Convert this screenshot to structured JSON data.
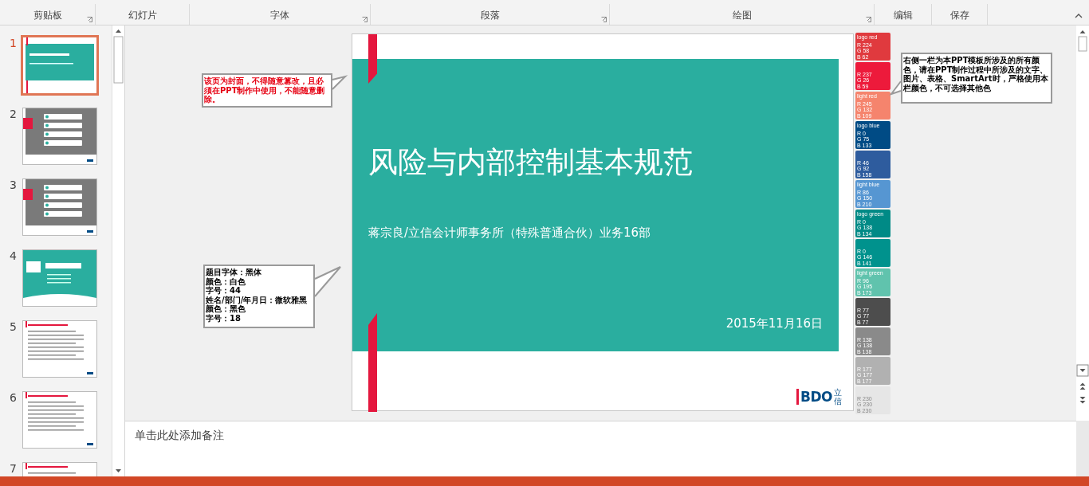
{
  "ribbon": {
    "groups": [
      {
        "label": "剪贴板",
        "launcher": true
      },
      {
        "label": "幻灯片",
        "launcher": false
      },
      {
        "label": "字体",
        "launcher": true
      },
      {
        "label": "段落",
        "launcher": true
      },
      {
        "label": "绘图",
        "launcher": true
      },
      {
        "label": "编辑",
        "launcher": false
      },
      {
        "label": "保存",
        "launcher": false
      }
    ]
  },
  "thumbnails": [
    {
      "number": "1",
      "kind": "cover",
      "selected": true
    },
    {
      "number": "2",
      "kind": "menu",
      "selected": false
    },
    {
      "number": "3",
      "kind": "menu",
      "selected": false
    },
    {
      "number": "4",
      "kind": "section",
      "selected": false
    },
    {
      "number": "5",
      "kind": "text",
      "selected": false
    },
    {
      "number": "6",
      "kind": "text",
      "selected": false
    },
    {
      "number": "7",
      "kind": "text",
      "selected": false
    }
  ],
  "slide": {
    "title": "风险与内部控制基本规范",
    "subtitle": "蒋宗良/立信会计师事务所（特殊普通合伙）业务16部",
    "date": "2015年11月16日",
    "logo_text": "BDO",
    "logo_cjk": "立信"
  },
  "callouts": [
    {
      "kind": "warning",
      "lines": [
        "该页为封面，不得随意篡改，且必须在PPT制作中使用，不能随意删除。"
      ]
    },
    {
      "kind": "note",
      "lines": [
        "题目字体：黑体",
        "颜色：白色",
        "字号：44",
        "姓名/部门/年月日：微软雅黑",
        "颜色：黑色",
        "字号：18"
      ]
    },
    {
      "kind": "note",
      "lines": [
        "右侧一栏为本PPT模板所涉及的所有颜色，请在PPT制作过程中所涉及的文字、图片、表格、SmartArt时，严格使用本栏颜色，不可选择其他色"
      ]
    }
  ],
  "swatches": [
    {
      "name": "logo red",
      "color": "#e03a3e",
      "r": "R 224",
      "g": "G 58",
      "b": "B 62"
    },
    {
      "color": "#ed1a3b",
      "r": "R 237",
      "g": "G 26",
      "b": "B 59"
    },
    {
      "name": "light red",
      "color": "#f5846d",
      "r": "R 245",
      "g": "G 132",
      "b": "B 109"
    },
    {
      "name": "logo blue",
      "color": "#004b85",
      "r": "R 0",
      "g": "G 75",
      "b": "B 133"
    },
    {
      "color": "#2e5c9e",
      "r": "R 46",
      "g": "G 92",
      "b": "B 158"
    },
    {
      "name": "light blue",
      "color": "#5696d2",
      "r": "R 86",
      "g": "G 150",
      "b": "B 210"
    },
    {
      "name": "logo green",
      "color": "#008a86",
      "r": "R 0",
      "g": "G 138",
      "b": "B 134"
    },
    {
      "color": "#00928d",
      "r": "R 0",
      "g": "G 146",
      "b": "B 141"
    },
    {
      "name": "light green",
      "color": "#60c3ad",
      "r": "R 96",
      "g": "G 195",
      "b": "B 173"
    },
    {
      "color": "#4d4d4d",
      "r": "R 77",
      "g": "G 77",
      "b": "B 77"
    },
    {
      "color": "#8a8a8a",
      "r": "R 138",
      "g": "G 138",
      "b": "B 138"
    },
    {
      "color": "#b1b1b1",
      "r": "R 177",
      "g": "G 177",
      "b": "B 177"
    },
    {
      "color": "#e6e6e6",
      "r": "R 230",
      "g": "G 230",
      "b": "B 230"
    }
  ],
  "notes": {
    "placeholder": "单击此处添加备注"
  }
}
